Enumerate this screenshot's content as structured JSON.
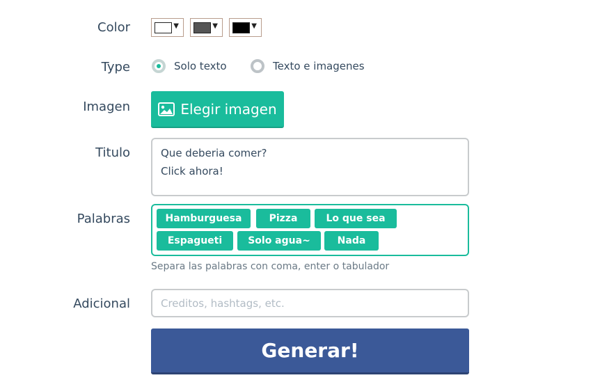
{
  "labels": {
    "color": "Color",
    "type": "Type",
    "imagen": "Imagen",
    "titulo": "Titulo",
    "palabras": "Palabras",
    "adicional": "Adicional"
  },
  "colors": {
    "swatch_1": "#ffffff",
    "swatch_2": "#555555",
    "swatch_3": "#000000",
    "accent": "#1abc9c",
    "primary": "#3b5998"
  },
  "type_options": [
    {
      "label": "Solo texto",
      "selected": true
    },
    {
      "label": "Texto e imagenes",
      "selected": false
    }
  ],
  "image_button": {
    "label": "Elegir imagen",
    "icon": "image-icon"
  },
  "titulo": {
    "value": "Que deberia comer?\nClick ahora!"
  },
  "palabras": {
    "tags": [
      "Hamburguesa",
      "Pizza",
      "Lo que sea",
      "Espagueti",
      "Solo agua~",
      "Nada"
    ],
    "hint": "Separa las palabras con coma, enter o tabulador"
  },
  "adicional": {
    "placeholder": "Creditos, hashtags, etc.",
    "value": ""
  },
  "submit": {
    "label": "Generar!"
  }
}
